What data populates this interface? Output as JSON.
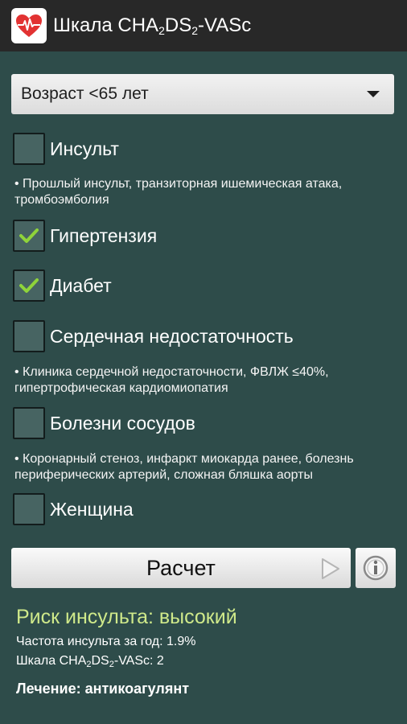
{
  "app": {
    "title_parts": [
      "Шкала CHA",
      "2",
      "DS",
      "2",
      "-VASc"
    ],
    "icon": "heart-ecg-icon",
    "brand_color": "#e23232"
  },
  "age_select": {
    "value": "Возраст <65 лет"
  },
  "criteria": [
    {
      "label": "Инсульт",
      "checked": false,
      "note": "• Прошлый инсульт, транзиторная ишемическая атака, тромбоэмболия"
    },
    {
      "label": "Гипертензия",
      "checked": true
    },
    {
      "label": "Диабет",
      "checked": true
    },
    {
      "label": "Сердечная недостаточность",
      "checked": false,
      "note": "• Клиника сердечной недостаточности, ФВЛЖ ≤40%, гипертрофическая кардиомиопатия"
    },
    {
      "label": "Болезни сосудов",
      "checked": false,
      "note": "• Коронарный стеноз, инфаркт миокарда ранее, болезнь периферических артерий, сложная бляшка аорты"
    },
    {
      "label": "Женщина",
      "checked": false
    }
  ],
  "actions": {
    "calculate_label": "Расчет",
    "play_icon": "play-icon",
    "info_icon": "info-icon"
  },
  "result": {
    "risk": "Риск инсульта: высокий",
    "annual_rate": "Частота инсульта за год: 1.9%",
    "score_parts": [
      "Шкала CHA",
      "2",
      "DS",
      "2",
      "-VASc: 2"
    ],
    "treatment": "Лечение: антикоагулянт",
    "risk_color": "#cfe98a"
  },
  "check_color": "#8fd43a"
}
